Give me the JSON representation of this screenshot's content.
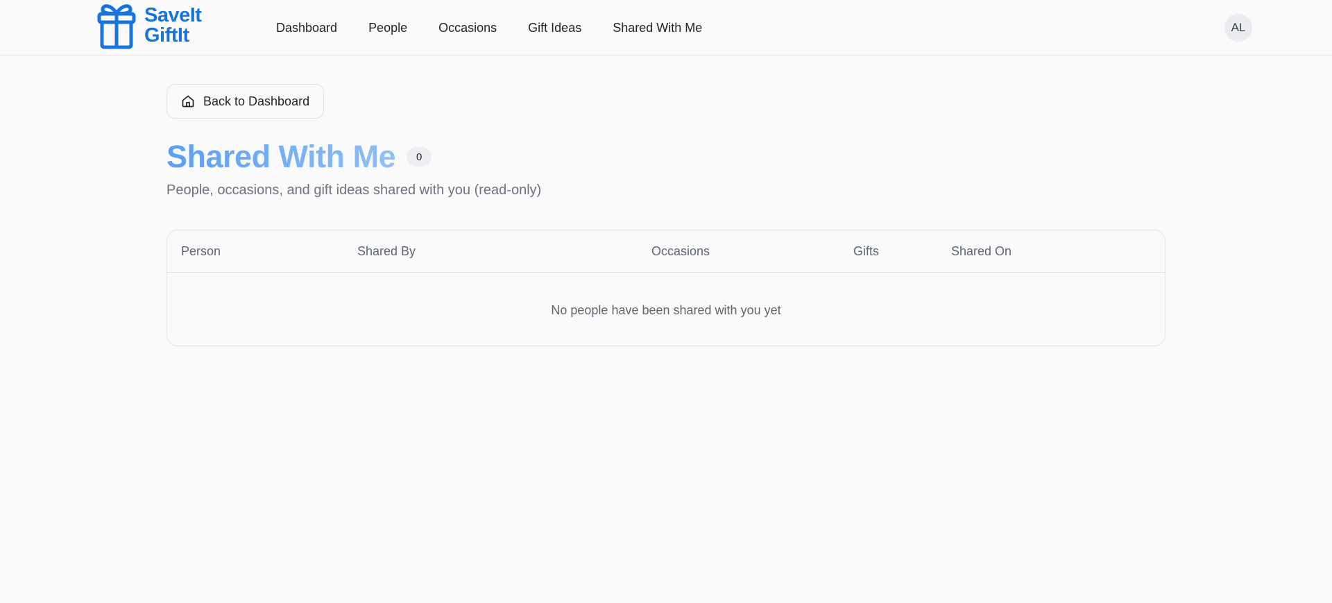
{
  "app": {
    "logo_line1": "SaveIt",
    "logo_line2": "GiftIt",
    "brand_color": "#1674dc",
    "logo_icon": "gift-icon"
  },
  "nav": {
    "items": [
      {
        "label": "Dashboard"
      },
      {
        "label": "People"
      },
      {
        "label": "Occasions"
      },
      {
        "label": "Gift Ideas"
      },
      {
        "label": "Shared With Me"
      }
    ]
  },
  "user": {
    "initials": "AL"
  },
  "back_button": {
    "label": "Back to Dashboard",
    "icon": "home-icon"
  },
  "page": {
    "title": "Shared With Me",
    "count": "0",
    "subtitle": "People, occasions, and gift ideas shared with you (read-only)"
  },
  "table": {
    "columns": [
      "Person",
      "Shared By",
      "Occasions",
      "Gifts",
      "Shared On"
    ],
    "empty_message": "No people have been shared with you yet"
  }
}
